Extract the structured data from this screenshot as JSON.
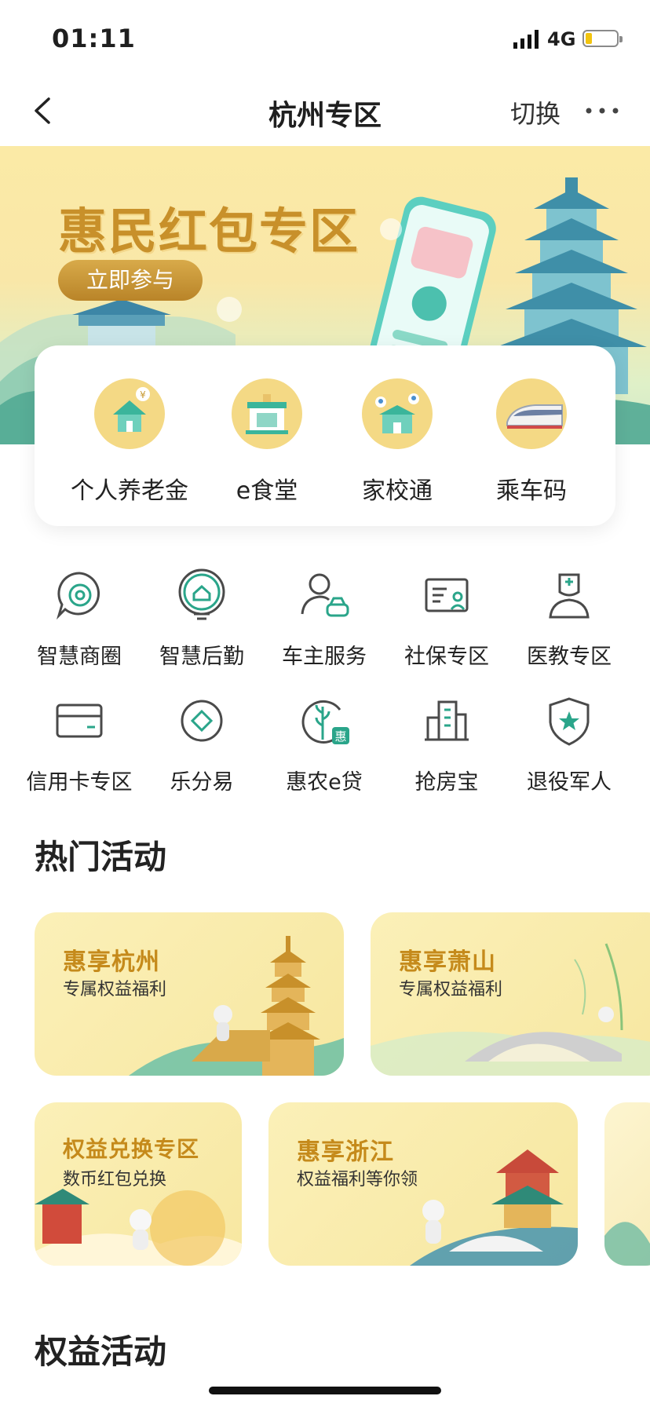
{
  "status_bar": {
    "time": "01:11",
    "network": "4G"
  },
  "nav": {
    "title": "杭州专区",
    "switch_label": "切换"
  },
  "banner": {
    "headline": "惠民红包专区",
    "cta": "立即参与"
  },
  "quick_card": [
    {
      "label": "个人养老金",
      "icon": "pension-house-icon"
    },
    {
      "label": "e食堂",
      "icon": "canteen-icon"
    },
    {
      "label": "家校通",
      "icon": "school-icon"
    },
    {
      "label": "乘车码",
      "icon": "train-icon"
    }
  ],
  "services": [
    {
      "label": "智慧商圈",
      "icon": "target-chat-icon"
    },
    {
      "label": "智慧后勤",
      "icon": "home-chat-icon"
    },
    {
      "label": "车主服务",
      "icon": "person-car-icon"
    },
    {
      "label": "社保专区",
      "icon": "id-card-icon"
    },
    {
      "label": "医教专区",
      "icon": "doctor-icon"
    },
    {
      "label": "信用卡专区",
      "icon": "credit-card-icon"
    },
    {
      "label": "乐分易",
      "icon": "diamond-circle-icon"
    },
    {
      "label": "惠农e贷",
      "icon": "wheat-icon"
    },
    {
      "label": "抢房宝",
      "icon": "building-icon"
    },
    {
      "label": "退役军人",
      "icon": "star-shield-icon"
    }
  ],
  "sections": {
    "hot": "热门活动",
    "benefits": "权益活动"
  },
  "activities": [
    {
      "title": "惠享杭州",
      "subtitle": "专属权益福利"
    },
    {
      "title": "惠享萧山",
      "subtitle": "专属权益福利"
    },
    {
      "title": "权益兑换专区",
      "subtitle": "数币红包兑换"
    },
    {
      "title": "惠享浙江",
      "subtitle": "权益福利等你领"
    }
  ],
  "colors": {
    "accent_green": "#2aa58a",
    "gold": "#c58a1b",
    "icon_gray": "#4a4a4a"
  }
}
